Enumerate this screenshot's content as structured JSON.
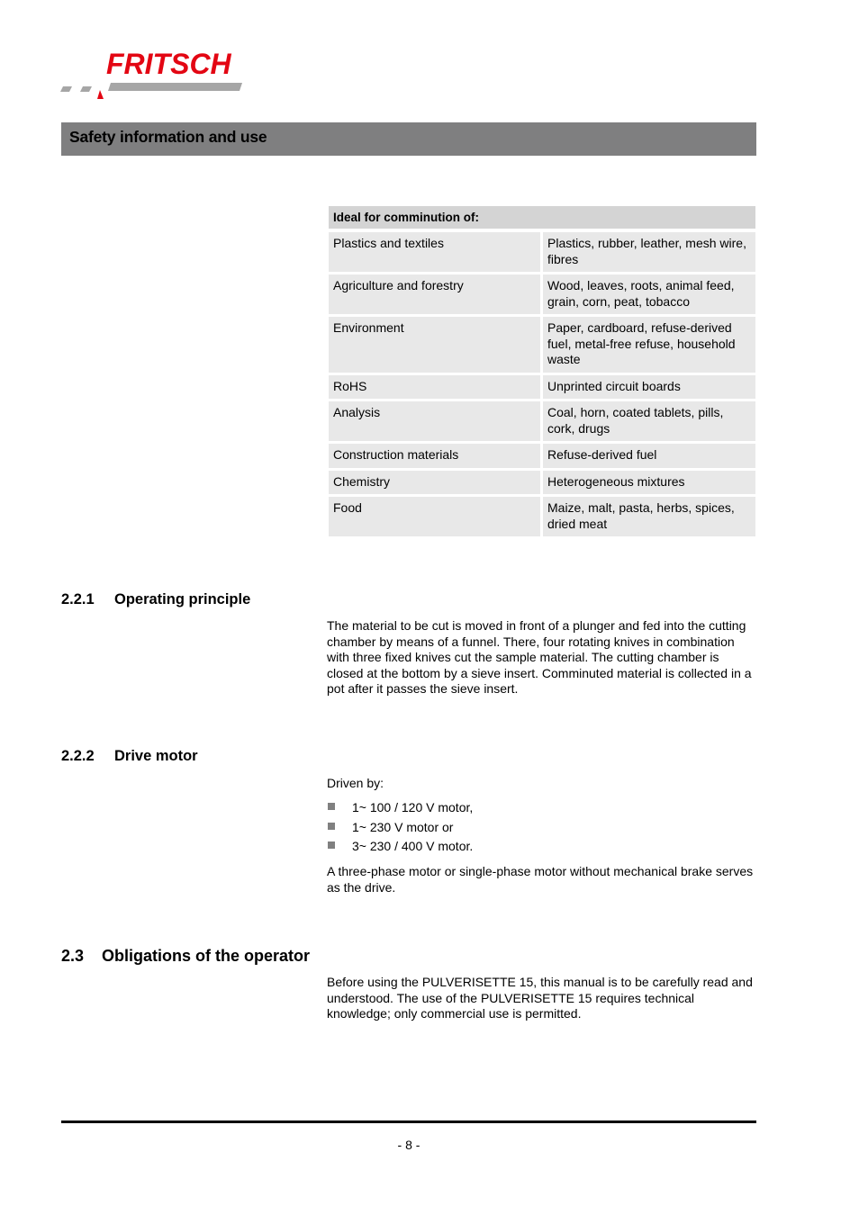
{
  "brand": {
    "name": "FRITSCH",
    "primary_color": "#e30613",
    "secondary_color": "#a6a6a6"
  },
  "header": {
    "title": "Safety information and use",
    "bar_color": "#7f7f80"
  },
  "comminution_table": {
    "header": "Ideal for comminution of:",
    "rows": [
      {
        "field": "Plastics and textiles",
        "materials": "Plastics, rubber, leather, mesh wire, fibres"
      },
      {
        "field": "Agriculture and forestry",
        "materials": "Wood, leaves, roots, animal feed, grain, corn, peat, tobacco"
      },
      {
        "field": "Environment",
        "materials": "Paper, cardboard, refuse-derived fuel, metal-free refuse, household waste"
      },
      {
        "field": "RoHS",
        "materials": "Unprinted circuit boards"
      },
      {
        "field": "Analysis",
        "materials": "Coal, horn, coated tablets, pills, cork, drugs"
      },
      {
        "field": "Construction materials",
        "materials": "Refuse-derived fuel"
      },
      {
        "field": "Chemistry",
        "materials": "Heterogeneous mixtures"
      },
      {
        "field": "Food",
        "materials": "Maize, malt, pasta, herbs, spices, dried meat"
      }
    ]
  },
  "sections": {
    "operating_principle": {
      "number": "2.2.1",
      "title": "Operating principle",
      "text": "The material to be cut is moved in front of a plunger and fed into the cutting chamber by means of a funnel. There, four rotating knives in combination with three fixed knives cut the sample material. The cutting chamber is closed at the bottom by a sieve insert. Comminuted material is collected in a pot after it passes the sieve insert."
    },
    "drive_motor": {
      "number": "2.2.2",
      "title": "Drive motor",
      "intro": "Driven by:",
      "bullets": [
        "1~ 100 / 120 V motor,",
        "1~ 230 V motor or",
        "3~ 230 / 400 V motor."
      ],
      "text": "A three-phase motor or single-phase motor without mechanical brake serves as the drive."
    },
    "obligations": {
      "number": "2.3",
      "title": "Obligations of the operator",
      "text": "Before using the PULVERISETTE 15, this manual is to be carefully read and understood. The use of the PULVERISETTE 15 requires technical knowledge; only commercial use is permitted."
    }
  },
  "footer": {
    "page_number": "- 8 -"
  }
}
